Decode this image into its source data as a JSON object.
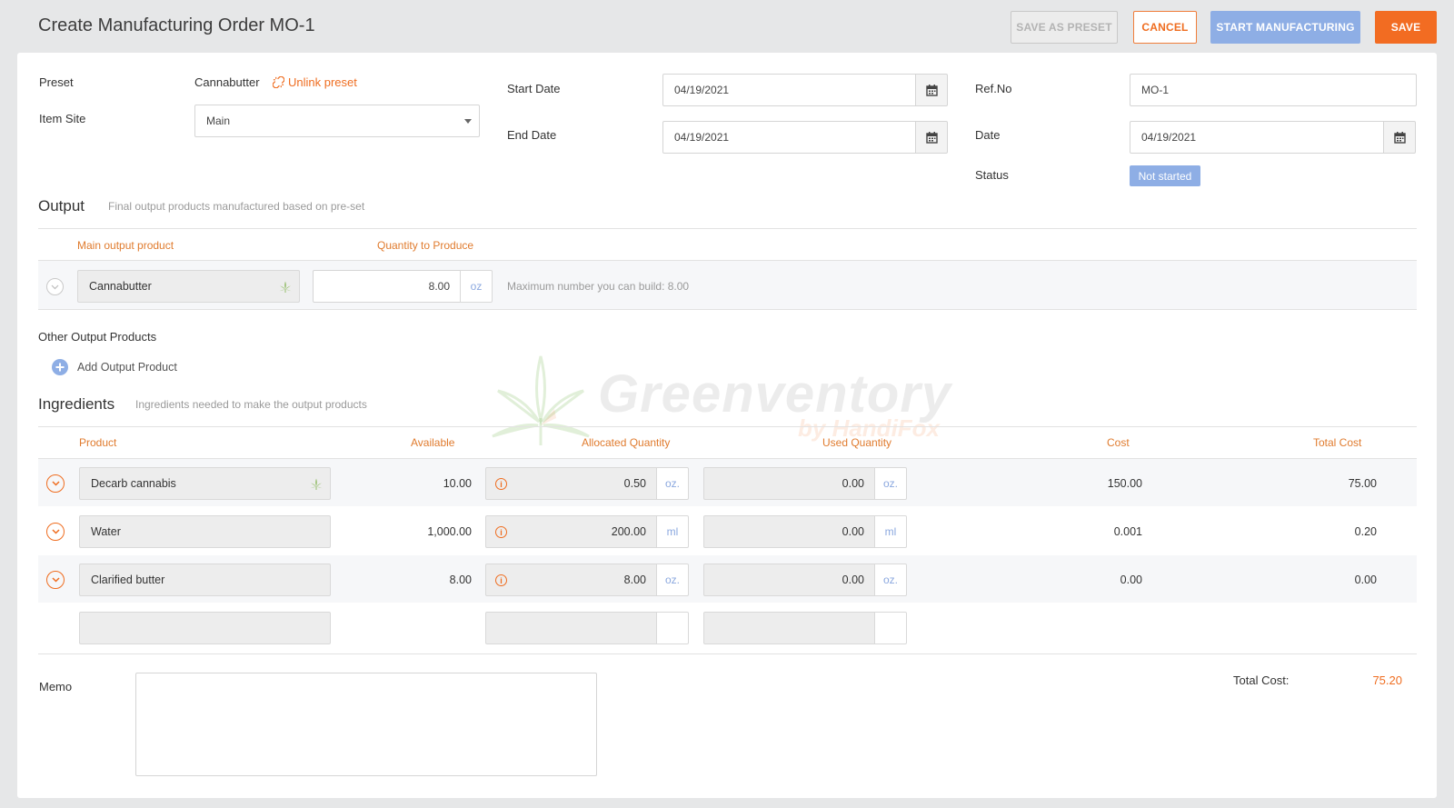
{
  "header": {
    "title": "Create Manufacturing Order MO-1",
    "save_as_preset": "SAVE AS PRESET",
    "cancel": "CANCEL",
    "start_manufacturing": "START MANUFACTURING",
    "save": "SAVE"
  },
  "form": {
    "preset_label": "Preset",
    "preset_value": "Cannabutter",
    "unlink_preset": "Unlink preset",
    "item_site_label": "Item Site",
    "item_site_value": "Main",
    "start_date_label": "Start Date",
    "start_date_value": "04/19/2021",
    "end_date_label": "End Date",
    "end_date_value": "04/19/2021",
    "ref_no_label": "Ref.No",
    "ref_no_value": "MO-1",
    "date_label": "Date",
    "date_value": "04/19/2021",
    "status_label": "Status",
    "status_value": "Not started"
  },
  "output": {
    "title": "Output",
    "subtitle": "Final output products manufactured based on pre-set",
    "col_main_product": "Main output product",
    "col_quantity": "Quantity to Produce",
    "product": "Cannabutter",
    "quantity": "8.00",
    "unit": "oz",
    "max_note": "Maximum number you can build: 8.00",
    "other_title": "Other Output Products",
    "add_output": "Add Output Product"
  },
  "ingredients": {
    "title": "Ingredients",
    "subtitle": "Ingredients needed to make the output products",
    "columns": {
      "product": "Product",
      "available": "Available",
      "allocated": "Allocated Quantity",
      "used": "Used Quantity",
      "cost": "Cost",
      "total_cost": "Total Cost"
    },
    "rows": [
      {
        "product": "Decarb cannabis",
        "available": "10.00",
        "allocated": "0.50",
        "allocated_unit": "oz.",
        "used": "0.00",
        "used_unit": "oz.",
        "cost": "150.00",
        "total": "75.00"
      },
      {
        "product": "Water",
        "available": "1,000.00",
        "allocated": "200.00",
        "allocated_unit": "ml",
        "used": "0.00",
        "used_unit": "ml",
        "cost": "0.001",
        "total": "0.20"
      },
      {
        "product": "Clarified butter",
        "available": "8.00",
        "allocated": "8.00",
        "allocated_unit": "oz.",
        "used": "0.00",
        "used_unit": "oz.",
        "cost": "0.00",
        "total": "0.00"
      }
    ]
  },
  "footer": {
    "memo_label": "Memo",
    "total_cost_label": "Total Cost:",
    "total_cost_value": "75.20"
  },
  "watermark": {
    "brand": "Greenventory",
    "by": "by HandiFox"
  },
  "colors": {
    "accent": "#f26c22",
    "primary_blue": "#8eaee5",
    "status_badge": "#8eaee5",
    "leaf_green": "#7fb24a"
  }
}
